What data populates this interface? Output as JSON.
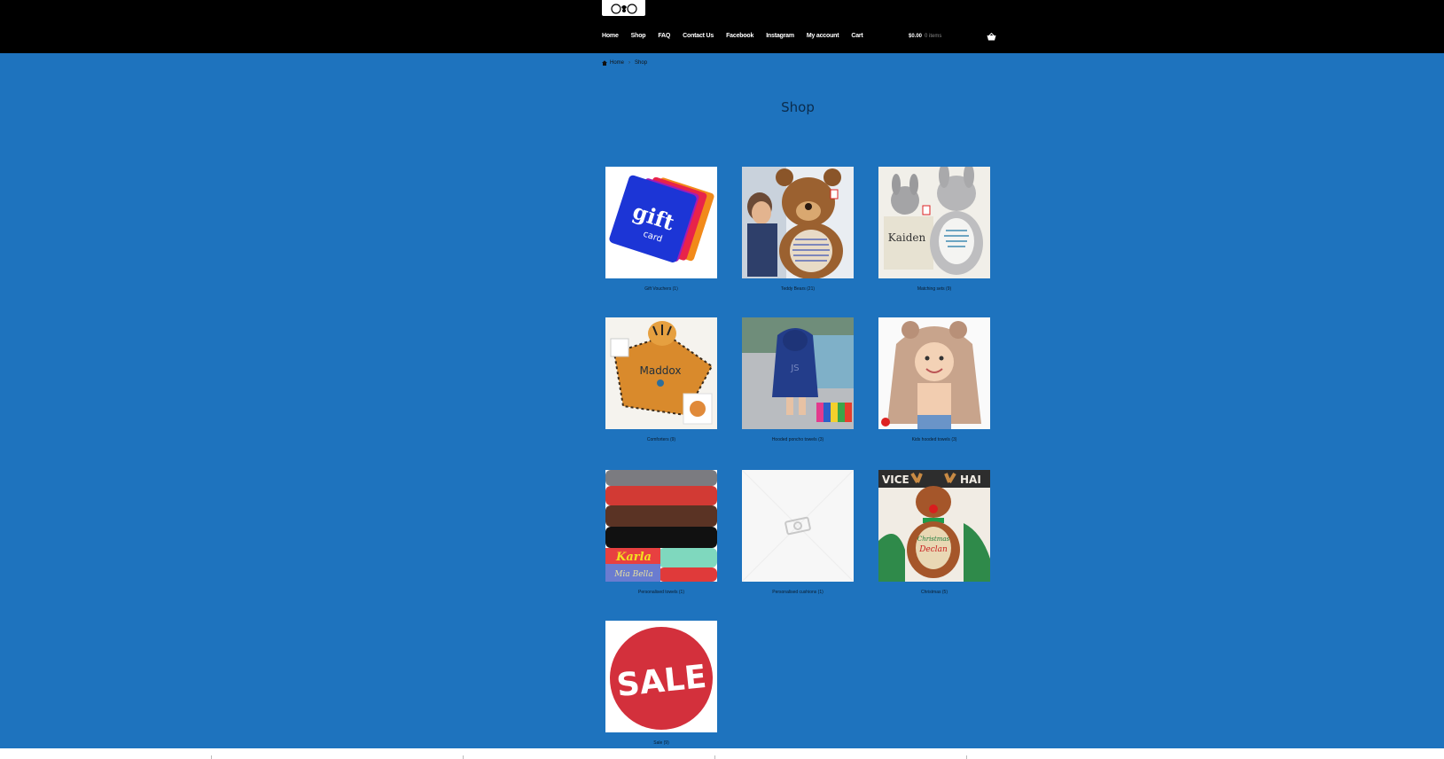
{
  "header": {
    "logo_name": "bear-logo",
    "nav": [
      "Home",
      "Shop",
      "FAQ",
      "Contact Us",
      "Facebook",
      "Instagram",
      "My account",
      "Cart"
    ],
    "cart_amount": "$0.00",
    "cart_items": "0 items"
  },
  "breadcrumb": {
    "home": "Home",
    "current": "Shop"
  },
  "page_title": "Shop",
  "categories": [
    {
      "label": "Gift Vouchers (1)"
    },
    {
      "label": "Teddy Bears (21)"
    },
    {
      "label": "Matching sets (9)"
    },
    {
      "label": "Comforters (9)"
    },
    {
      "label": "Hooded poncho towels (3)"
    },
    {
      "label": "Kids hooded towels (3)"
    },
    {
      "label": "Personalised towels (1)"
    },
    {
      "label": "Personalised cushions (1)"
    },
    {
      "label": "Christmas (5)"
    },
    {
      "label": "Sale (9)"
    }
  ],
  "image_text": {
    "gift": "gift",
    "card": "card",
    "maddox": "Maddox",
    "kaiden": "Kaiden",
    "karla": "Karla",
    "sale": "SALE",
    "declan": "Declan"
  },
  "colors": {
    "background": "#1e73be",
    "header": "#000000",
    "sale_red": "#d3303c"
  }
}
